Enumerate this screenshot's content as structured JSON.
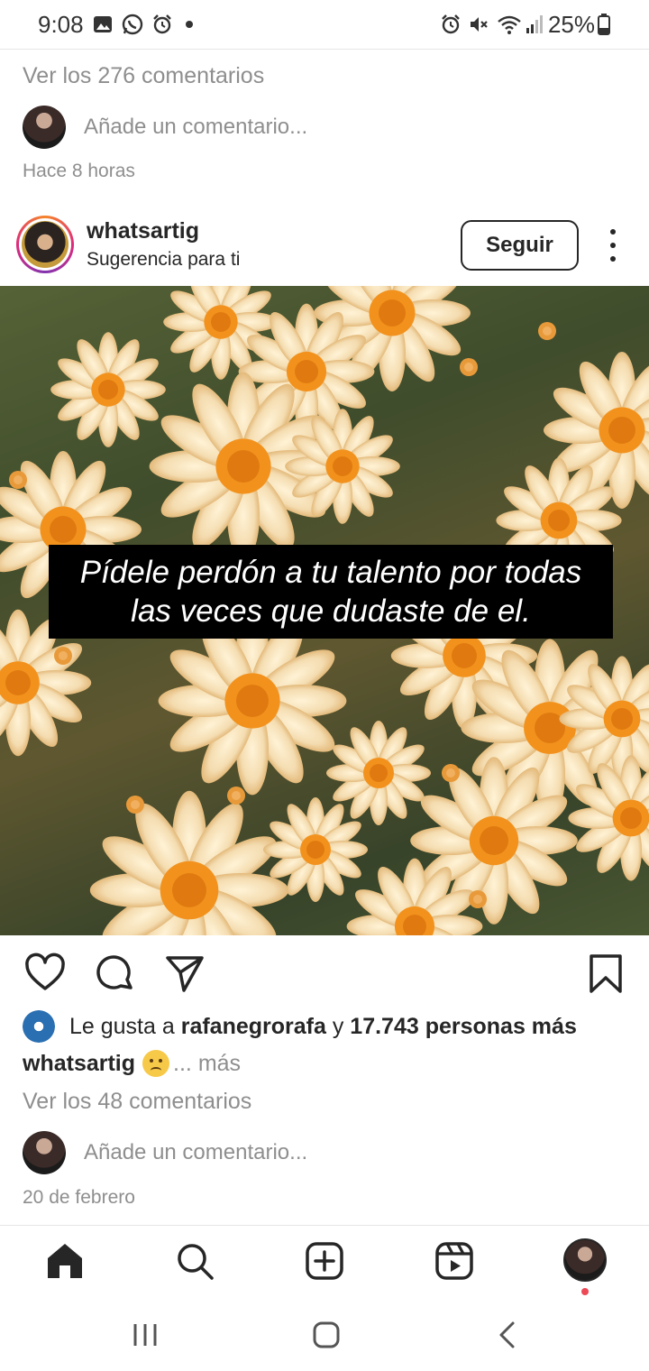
{
  "status_bar": {
    "time": "9:08",
    "battery": "25%",
    "icons": [
      "gallery-icon",
      "whatsapp-icon",
      "alarm-icon",
      "dot-icon",
      "alarm-icon",
      "mute-icon",
      "wifi-icon",
      "signal-icon",
      "battery-icon"
    ]
  },
  "previous_post": {
    "comments_link": "Ver los 276 comentarios",
    "add_comment_placeholder": "Añade un comentario...",
    "time_ago": "Hace 8 horas"
  },
  "post": {
    "username": "whatsartig",
    "subtitle": "Sugerencia para ti",
    "follow_label": "Seguir",
    "image_caption_line1": "Pídele perdón a tu talento por todas",
    "image_caption_line2": "las veces que dudaste de el.",
    "likes_prefix": "Le gusta a",
    "likes_user": "rafanegrorafa",
    "likes_connector": "y",
    "likes_rest": "17.743 personas más",
    "caption_user": "whatsartig",
    "caption_more": "... más",
    "comments_link": "Ver los 48 comentarios",
    "add_comment_placeholder": "Añade un comentario...",
    "date": "20 de febrero"
  },
  "actions": [
    "heart-icon",
    "comment-icon",
    "share-icon",
    "bookmark-icon"
  ],
  "bottom_nav": [
    "home-icon",
    "search-icon",
    "add-post-icon",
    "reels-icon",
    "profile-avatar"
  ],
  "system_nav": [
    "recent-apps-button",
    "home-button",
    "back-button"
  ],
  "colors": {
    "text": "#262626",
    "secondary_text": "#8e8e8e",
    "notification": "#ed4956",
    "flower_petal": "#f6e8c8",
    "flower_center": "#f2921d"
  }
}
